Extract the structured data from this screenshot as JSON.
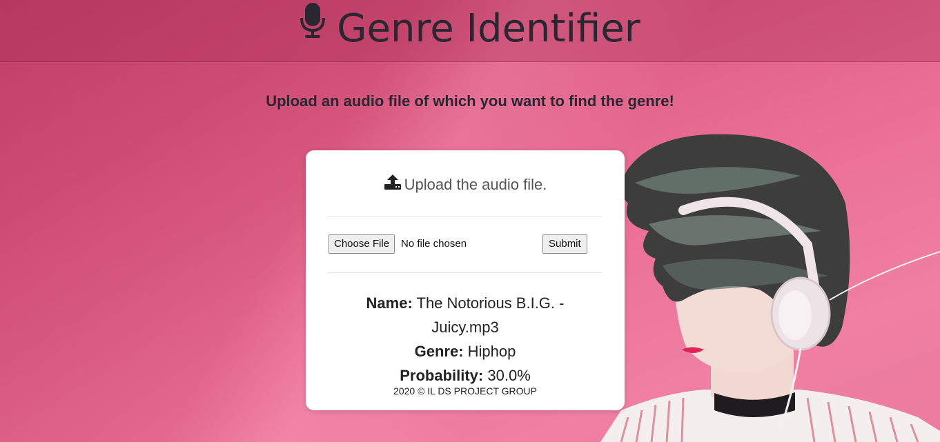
{
  "header": {
    "title": "Genre Identifier",
    "icon": "microphone-icon"
  },
  "subtitle": "Upload an audio file of which you want to find the genre!",
  "card": {
    "heading": "Upload the audio file.",
    "heading_icon": "upload-icon",
    "file_input": {
      "button_label": "Choose File",
      "status": "No file chosen"
    },
    "submit_label": "Submit",
    "result": {
      "name_label": "Name:",
      "name_value_line1": "The Notorious B.I.G. -",
      "name_value_line2": "Juicy.mp3",
      "genre_label": "Genre:",
      "genre_value": "Hiphop",
      "probability_label": "Probability:",
      "probability_value": "30.0%"
    },
    "footer": "2020 © IL DS PROJECT GROUP"
  },
  "colors": {
    "background": "#e8658e",
    "header_overlay": "#b2385f",
    "text_dark": "#2b2730",
    "card": "#ffffff"
  }
}
